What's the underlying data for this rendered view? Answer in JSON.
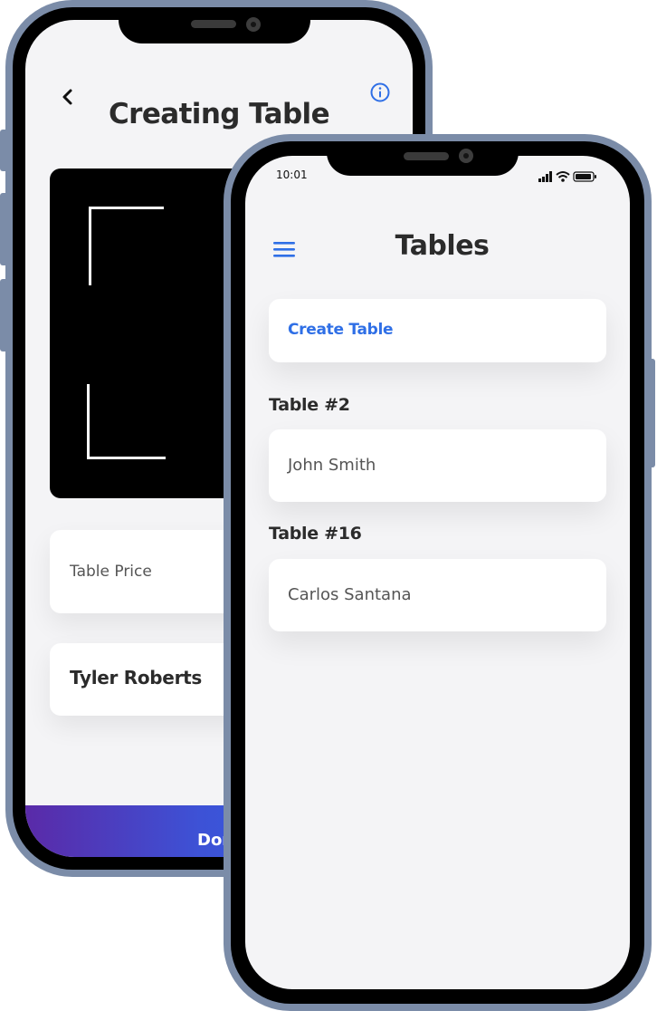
{
  "back_screen": {
    "title": "Creating Table",
    "back_icon": "chevron-left-icon",
    "info_icon": "info-icon",
    "table_price_placeholder": "Table Price",
    "customer_name": "Tyler Roberts",
    "done_button_label": "Don"
  },
  "front_screen": {
    "status_time": "10:01",
    "status_icons": [
      "signal-icon",
      "wifi-icon",
      "battery-icon"
    ],
    "menu_icon": "hamburger-menu-icon",
    "title": "Tables",
    "create_button_label": "Create Table",
    "tables": [
      {
        "label": "Table #2",
        "name": "John Smith"
      },
      {
        "label": "Table #16",
        "name": "Carlos Santana"
      }
    ]
  },
  "colors": {
    "accent_blue": "#2f6fe6",
    "frame": "#7b8ca8",
    "screen_bg": "#f4f4f6",
    "gradient_start": "#5a2aa8",
    "gradient_end": "#2a63e8"
  }
}
